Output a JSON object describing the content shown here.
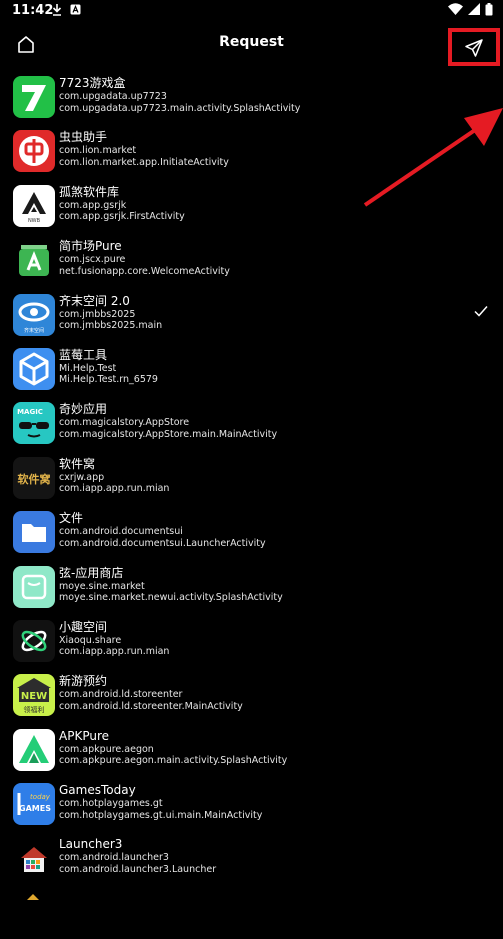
{
  "status_bar": {
    "time": "11:42"
  },
  "header": {
    "title": "Request"
  },
  "colors": {
    "annotation": "#e51b23",
    "background": "#000000",
    "text": "#ffffff"
  },
  "apps": [
    {
      "name": "7723游戏盒",
      "package": "com.upgadata.up7723",
      "activity": "com.upgadata.up7723.main.activity.SplashActivity",
      "icon": "7723-icon",
      "selected": false
    },
    {
      "name": "虫虫助手",
      "package": "com.lion.market",
      "activity": "com.lion.market.app.InitiateActivity",
      "icon": "chongchong-icon",
      "selected": false
    },
    {
      "name": "孤煞软件库",
      "package": "com.app.gsrjk",
      "activity": "com.app.gsrjk.FirstActivity",
      "icon": "gusha-icon",
      "selected": false
    },
    {
      "name": "简市场Pure",
      "package": "com.jscx.pure",
      "activity": "net.fusionapp.core.WelcomeActivity",
      "icon": "jianshichang-icon",
      "selected": false
    },
    {
      "name": "齐末空间 2.0",
      "package": "com.jmbbs2025",
      "activity": "com.jmbbs2025.main",
      "icon": "qimo-icon",
      "selected": true
    },
    {
      "name": "蓝莓工具",
      "package": "Mi.Help.Test",
      "activity": "Mi.Help.Test.rn_6579",
      "icon": "lanmei-icon",
      "selected": false
    },
    {
      "name": "奇妙应用",
      "package": "com.magicalstory.AppStore",
      "activity": "com.magicalstory.AppStore.main.MainActivity",
      "icon": "magic-icon",
      "selected": false
    },
    {
      "name": "软件窝",
      "package": "cxrjw.app",
      "activity": "com.iapp.app.run.mian",
      "icon": "ruanjianwo-icon",
      "selected": false
    },
    {
      "name": "文件",
      "package": "com.android.documentsui",
      "activity": "com.android.documentsui.LauncherActivity",
      "icon": "folder-icon",
      "selected": false
    },
    {
      "name": "弦-应用商店",
      "package": "moye.sine.market",
      "activity": "moye.sine.market.newui.activity.SplashActivity",
      "icon": "sine-icon",
      "selected": false
    },
    {
      "name": "小趣空间",
      "package": "Xiaoqu.share",
      "activity": "com.iapp.app.run.mian",
      "icon": "xiaoqu-icon",
      "selected": false
    },
    {
      "name": "新游预约",
      "package": "com.android.ld.storeenter",
      "activity": "com.android.ld.storeenter.MainActivity",
      "icon": "xinyou-icon",
      "selected": false
    },
    {
      "name": "APKPure",
      "package": "com.apkpure.aegon",
      "activity": "com.apkpure.aegon.main.activity.SplashActivity",
      "icon": "apkpure-icon",
      "selected": false
    },
    {
      "name": "GamesToday",
      "package": "com.hotplaygames.gt",
      "activity": "com.hotplaygames.gt.ui.main.MainActivity",
      "icon": "gamestoday-icon",
      "selected": false
    },
    {
      "name": "Launcher3",
      "package": "com.android.launcher3",
      "activity": "com.android.launcher3.Launcher",
      "icon": "launcher3-icon",
      "selected": false
    },
    {
      "name": "",
      "package": "",
      "activity": "",
      "icon": "partial-icon",
      "selected": false
    }
  ],
  "icon_text": {
    "nwb": "NWB",
    "magic": "MAGIC",
    "ruanjianwo": "软件窝",
    "new_badge": "NEW",
    "xinyou_sub": "领福利",
    "gt_top": "today",
    "gt_bottom": "GAMES",
    "qimo_sub": "齐末空间"
  }
}
